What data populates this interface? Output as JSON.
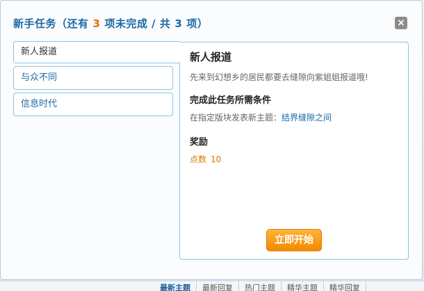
{
  "header": {
    "title_prefix": "新手任务（还有",
    "remaining_count": "3",
    "title_mid": "项未完成 / 共",
    "total_count": "3",
    "title_suffix": "项）"
  },
  "tabs": [
    {
      "label": "新人报道",
      "active": true
    },
    {
      "label": "与众不同",
      "active": false
    },
    {
      "label": "信息时代",
      "active": false
    }
  ],
  "detail": {
    "title": "新人报道",
    "description": "先来到幻想乡的居民都要去缝隙向紫姐姐报道哦!",
    "conditions_heading": "完成此任务所需条件",
    "condition_text": "在指定版块发表新主题：",
    "condition_link": "结界缝隙之间",
    "reward_heading": "奖励",
    "reward_label": "点数",
    "reward_value": "10",
    "start_button": "立即开始"
  },
  "close_label": "×",
  "colors": {
    "accent": "#1a6aa6",
    "highlight": "#e86b00",
    "button": "#f28a00",
    "border": "#8cc3e0"
  }
}
